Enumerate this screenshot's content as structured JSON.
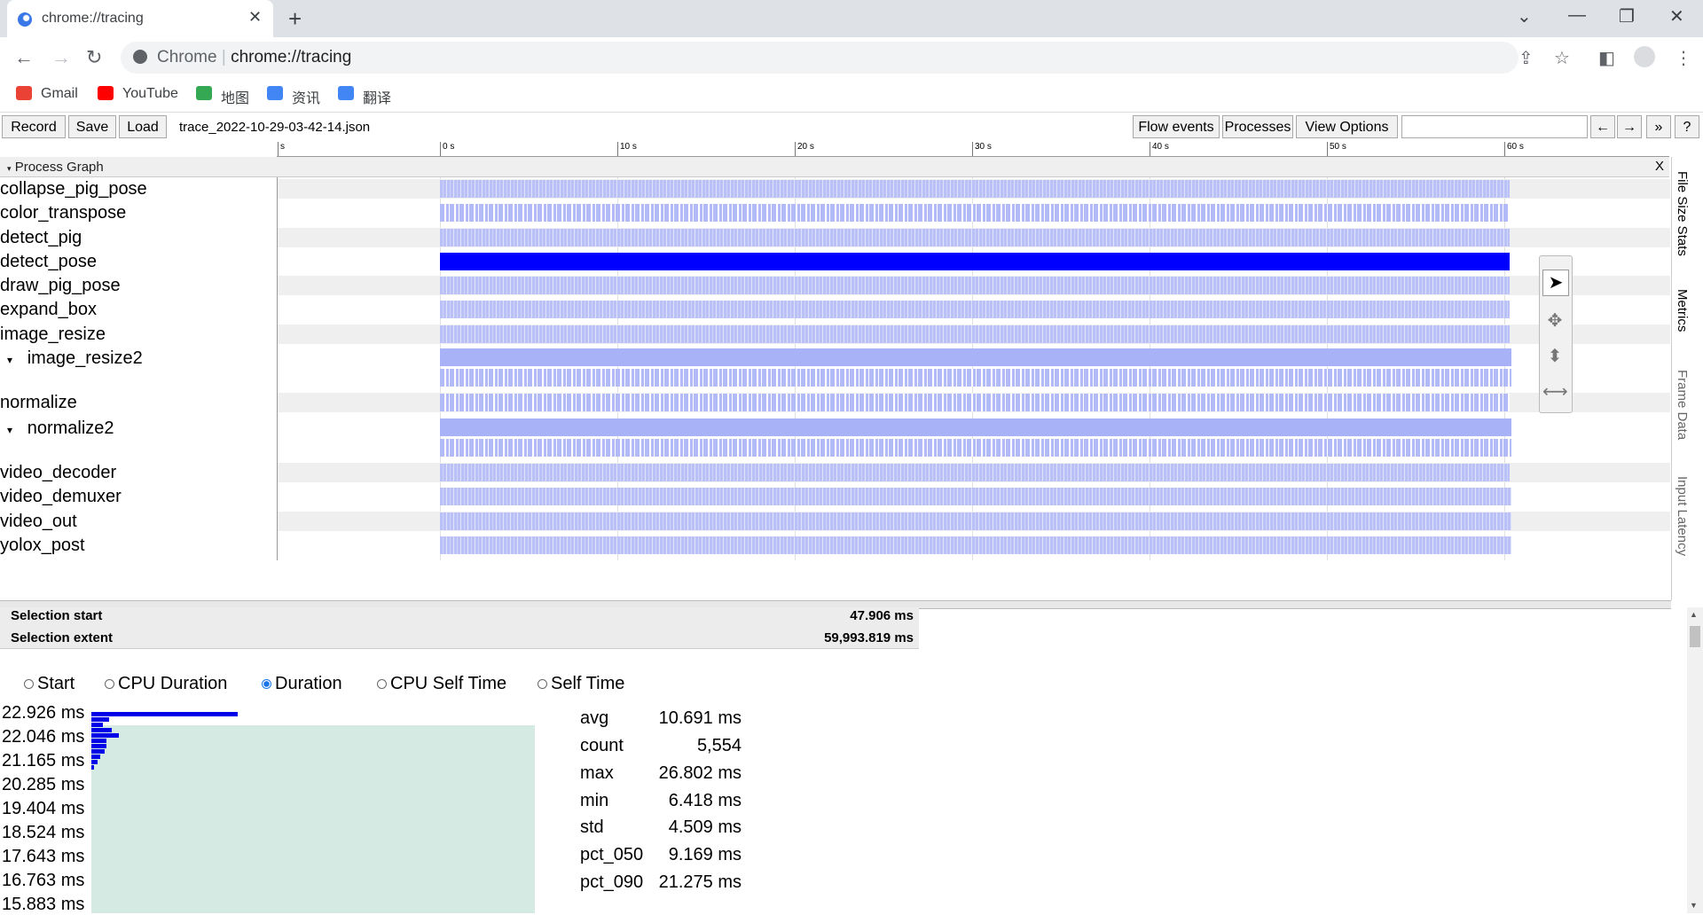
{
  "browser": {
    "tab_title": "chrome://tracing",
    "tab_close": "✕",
    "new_tab": "+",
    "window_buttons": {
      "dropdown": "⌄",
      "minimize": "—",
      "restore": "❐",
      "close": "✕"
    },
    "omnibox_prefix": "Chrome",
    "omnibox_separator": "|",
    "omnibox_url": "chrome://tracing",
    "bookmarks": [
      {
        "label": "Gmail",
        "icon": "gmail-icon",
        "color": "#ea4335"
      },
      {
        "label": "YouTube",
        "icon": "youtube-icon",
        "color": "#ff0000"
      },
      {
        "label": "地图",
        "icon": "maps-icon",
        "color": "#34a853"
      },
      {
        "label": "资讯",
        "icon": "news-icon",
        "color": "#4285f4"
      },
      {
        "label": "翻译",
        "icon": "translate-icon",
        "color": "#4285f4"
      }
    ]
  },
  "tracing": {
    "buttons": {
      "record": "Record",
      "save": "Save",
      "load": "Load"
    },
    "file_name": "trace_2022-10-29-03-42-14.json",
    "right_buttons": {
      "flow_events": "Flow events",
      "processes": "Processes",
      "view_options": "View Options",
      "prev": "←",
      "next": "→",
      "expand": "»",
      "help": "?"
    },
    "ruler_ticks": [
      "s",
      "0 s",
      "10 s",
      "20 s",
      "30 s",
      "40 s",
      "50 s",
      "60 s"
    ],
    "process_graph_title": "Process Graph",
    "process_graph_close": "X",
    "tracks": [
      {
        "label": "collapse_pig_pose",
        "style": "normal"
      },
      {
        "label": "color_transpose",
        "style": "normal"
      },
      {
        "label": "detect_pig",
        "style": "normal"
      },
      {
        "label": "detect_pose",
        "style": "solid"
      },
      {
        "label": "draw_pig_pose",
        "style": "normal"
      },
      {
        "label": "expand_box",
        "style": "normal"
      },
      {
        "label": "image_resize",
        "style": "normal"
      },
      {
        "label": "image_resize2",
        "style": "expanded"
      },
      {
        "label": "normalize",
        "style": "normal"
      },
      {
        "label": "normalize2",
        "style": "expanded"
      },
      {
        "label": "video_decoder",
        "style": "normal"
      },
      {
        "label": "video_demuxer",
        "style": "normal"
      },
      {
        "label": "video_out",
        "style": "normal"
      },
      {
        "label": "yolox_post",
        "style": "normal"
      }
    ],
    "expand_glyph": "▾",
    "side_tabs": [
      "File Size Stats",
      "Metrics",
      "Frame Data",
      "Input Latency"
    ],
    "palette_icons": [
      "select-icon",
      "pan-icon",
      "zoom-icon",
      "timing-icon"
    ],
    "selection": {
      "start_label": "Selection start",
      "start_value": "47.906 ms",
      "extent_label": "Selection extent",
      "extent_value": "59,993.819 ms"
    },
    "radio_options": [
      {
        "label": "Start",
        "checked": false
      },
      {
        "label": "CPU Duration",
        "checked": false
      },
      {
        "label": "Duration",
        "checked": true
      },
      {
        "label": "CPU Self Time",
        "checked": false
      },
      {
        "label": "Self Time",
        "checked": false
      }
    ],
    "histogram": {
      "labels": [
        "22.926 ms",
        "22.046 ms",
        "21.165 ms",
        "20.285 ms",
        "19.404 ms",
        "18.524 ms",
        "17.643 ms",
        "16.763 ms",
        "15.883 ms"
      ],
      "bar_fractions": [
        1.0,
        0.12,
        0.08,
        0.14,
        0.19,
        0.1,
        0.1,
        0.09,
        0.06,
        0.04,
        0.02
      ]
    },
    "stats": [
      {
        "name": "avg",
        "value": "10.691 ms"
      },
      {
        "name": "count",
        "value": "5,554"
      },
      {
        "name": "max",
        "value": "26.802 ms"
      },
      {
        "name": "min",
        "value": "6.418 ms"
      },
      {
        "name": "std",
        "value": "4.509 ms"
      },
      {
        "name": "pct_050",
        "value": "9.169 ms"
      },
      {
        "name": "pct_090",
        "value": "21.275 ms"
      }
    ]
  }
}
